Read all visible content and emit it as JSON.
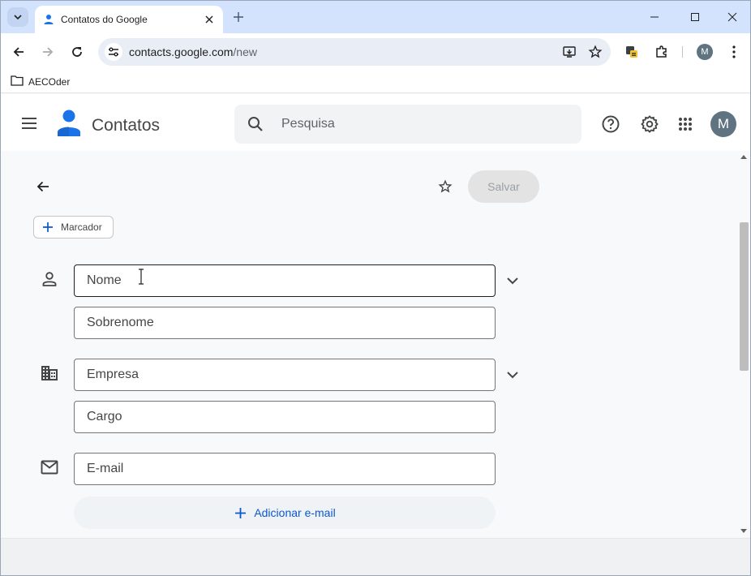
{
  "browser": {
    "tab_title": "Contatos do Google",
    "url_host": "contacts.google.com",
    "url_path": "/new",
    "profile_initial": "M",
    "bookmark_folder": "AECOder"
  },
  "app": {
    "title": "Contatos",
    "search_placeholder": "Pesquisa",
    "avatar_initial": "M",
    "accent_color": "#0b57d0"
  },
  "toolbar": {
    "save_label": "Salvar",
    "label_button": "Marcador"
  },
  "form": {
    "first_name_placeholder": "Nome",
    "last_name_placeholder": "Sobrenome",
    "company_placeholder": "Empresa",
    "job_title_placeholder": "Cargo",
    "email_placeholder": "E-mail",
    "add_email_label": "Adicionar e-mail"
  },
  "icons": [
    "tab-search-icon",
    "contacts-favicon",
    "close-icon",
    "plus-icon",
    "minimize-icon",
    "maximize-icon",
    "back-icon",
    "forward-icon",
    "reload-icon",
    "tune-icon",
    "install-icon",
    "star-icon",
    "extension-icon",
    "puzzle-icon",
    "more-vert-icon",
    "folder-icon",
    "menu-icon",
    "search-icon",
    "help-icon",
    "settings-icon",
    "apps-icon",
    "person-icon",
    "business-icon",
    "mail-icon",
    "chevron-down-icon",
    "arrow-back-icon"
  ]
}
